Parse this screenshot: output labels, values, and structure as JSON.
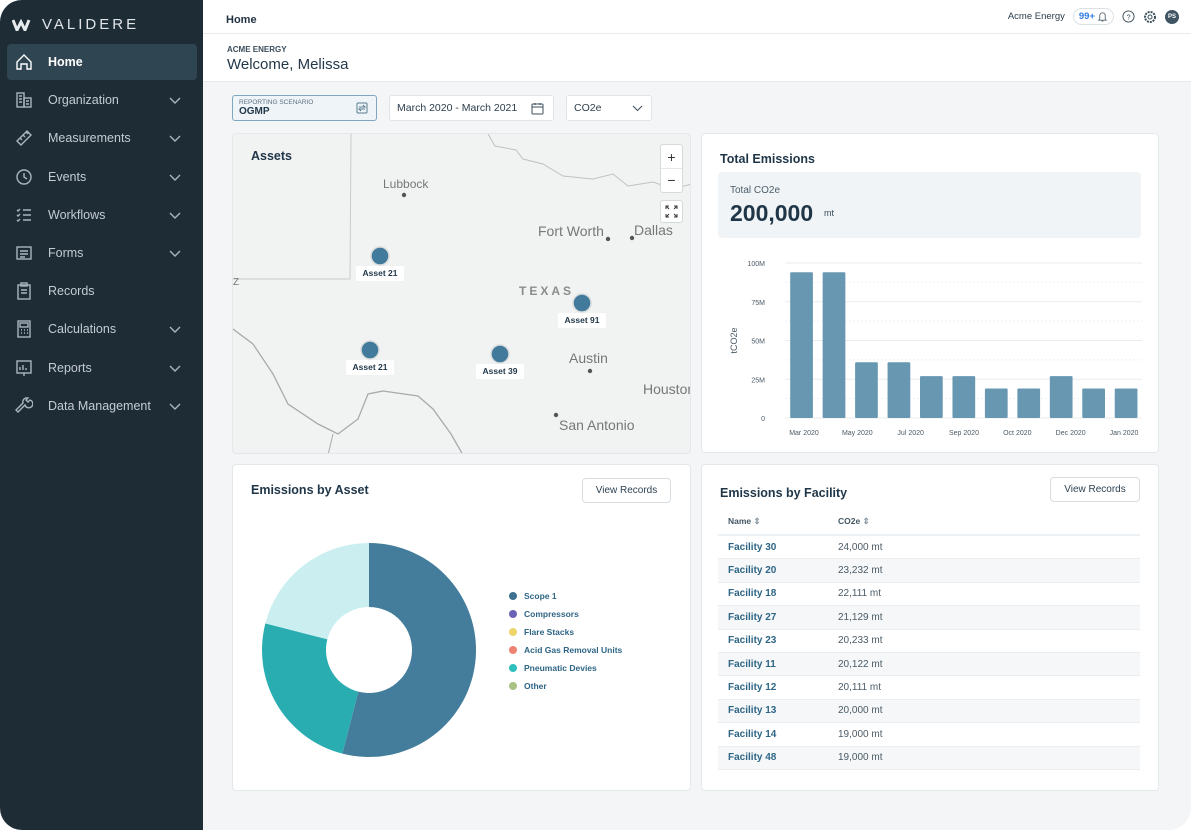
{
  "app": {
    "brand": "VALIDERE"
  },
  "sidebar": {
    "items": [
      {
        "label": "Home",
        "icon": "home-icon",
        "active": true,
        "expandable": false
      },
      {
        "label": "Organization",
        "icon": "building-icon",
        "expandable": true
      },
      {
        "label": "Measurements",
        "icon": "ruler-icon",
        "expandable": true
      },
      {
        "label": "Events",
        "icon": "clock-icon",
        "expandable": true
      },
      {
        "label": "Workflows",
        "icon": "checklist-icon",
        "expandable": true
      },
      {
        "label": "Forms",
        "icon": "form-icon",
        "expandable": true
      },
      {
        "label": "Records",
        "icon": "clipboard-icon",
        "expandable": false
      },
      {
        "label": "Calculations",
        "icon": "calculator-icon",
        "expandable": true
      },
      {
        "label": "Reports",
        "icon": "chart-icon",
        "expandable": true
      },
      {
        "label": "Data Management",
        "icon": "wrench-icon",
        "expandable": true
      }
    ]
  },
  "topbar": {
    "breadcrumb": "Home",
    "company": "Acme Energy",
    "notifications": "99+",
    "avatar": "PS"
  },
  "header": {
    "org": "ACME ENERGY",
    "welcome": "Welcome, Melissa"
  },
  "filters": {
    "scenario_label": "REPORTING SCENARIO",
    "scenario_value": "OGMP",
    "date_range": "March 2020 - March 2021",
    "metric": "CO2e"
  },
  "map": {
    "title": "Assets",
    "zoom_in": "+",
    "zoom_out": "−",
    "cities": [
      "Lubbock",
      "Fort Worth",
      "Dallas",
      "Austin",
      "Houston",
      "San Antonio"
    ],
    "state_label": "TEXAS",
    "edge_label": "Z",
    "assets": [
      "Asset 21",
      "Asset 91",
      "Asset 21",
      "Asset 39"
    ],
    "marker_color": "#417a9b"
  },
  "total": {
    "title": "Total Emissions",
    "kpi_label": "Total CO2e",
    "kpi_value": "200,000",
    "kpi_unit": "mt"
  },
  "chart_data": [
    {
      "type": "bar",
      "ylabel": "tCO2e",
      "ylim": [
        0,
        100000000
      ],
      "grid": true,
      "yticks": [
        "0",
        "25M",
        "50M",
        "75M",
        "100M"
      ],
      "xticks": [
        "Mar 2020",
        "May 2020",
        "Jul 2020",
        "Sep 2020",
        "Oct 2020",
        "Dec 2020",
        "Jan 2020"
      ],
      "values": [
        94000000,
        94000000,
        36000000,
        36000000,
        27000000,
        27000000,
        19000000,
        19000000,
        27000000,
        19000000,
        19000000
      ],
      "color": "#6897b2"
    },
    {
      "type": "pie",
      "title": "Emissions by Asset",
      "donut": true,
      "slices": [
        {
          "value": 54,
          "color": "#447d9b"
        },
        {
          "value": 25,
          "color": "#2aadb1"
        },
        {
          "value": 21,
          "color": "#cbeff1"
        }
      ],
      "legend": [
        {
          "name": "Scope 1",
          "color": "#3f7291"
        },
        {
          "name": "Compressors",
          "color": "#6b63b5"
        },
        {
          "name": "Flare Stacks",
          "color": "#ecd56b"
        },
        {
          "name": "Acid Gas Removal Units",
          "color": "#ef8373"
        },
        {
          "name": "Pneumatic Devies",
          "color": "#2fc0bd"
        },
        {
          "name": "Other",
          "color": "#a9c283"
        }
      ]
    }
  ],
  "asset_card": {
    "title": "Emissions by Asset",
    "button": "View Records"
  },
  "facility": {
    "title": "Emissions by Facility",
    "button": "View Records",
    "columns": [
      "Name",
      "CO2e"
    ],
    "rows": [
      [
        "Facility 30",
        "24,000 mt"
      ],
      [
        "Facility 20",
        "23,232 mt"
      ],
      [
        "Facility 18",
        "22,111 mt"
      ],
      [
        "Facility 27",
        "21,129 mt"
      ],
      [
        "Facility 23",
        "20,233 mt"
      ],
      [
        "Facility 11",
        "20,122 mt"
      ],
      [
        "Facility 12",
        "20,111 mt"
      ],
      [
        "Facility 13",
        "20,000 mt"
      ],
      [
        "Facility 14",
        "19,000 mt"
      ],
      [
        "Facility 48",
        "19,000 mt"
      ]
    ]
  }
}
